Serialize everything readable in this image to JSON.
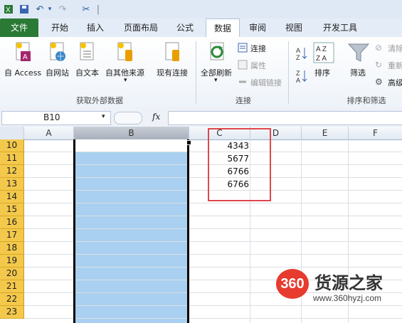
{
  "quick_access": {
    "undo_arrow": "▾",
    "separator": "|"
  },
  "tabs": [
    {
      "label": "文件"
    },
    {
      "label": "开始"
    },
    {
      "label": "插入"
    },
    {
      "label": "页面布局"
    },
    {
      "label": "公式"
    },
    {
      "label": "数据"
    },
    {
      "label": "审阅"
    },
    {
      "label": "视图"
    },
    {
      "label": "开发工具"
    }
  ],
  "ribbon": {
    "external_group": {
      "label": "获取外部数据",
      "buttons": [
        {
          "label": "自 Access"
        },
        {
          "label": "自网站"
        },
        {
          "label": "自文本"
        },
        {
          "label": "自其他来源"
        }
      ],
      "existing_label": "现有连接"
    },
    "connections_group": {
      "label": "连接",
      "refresh_label": "全部刷新",
      "items": [
        {
          "label": "连接"
        },
        {
          "label": "属性"
        },
        {
          "label": "编辑链接"
        }
      ]
    },
    "sort_group": {
      "label": "排序和筛选",
      "sort_label": "排序",
      "filter_label": "筛选",
      "items": [
        {
          "label": "清除"
        },
        {
          "label": "重新"
        },
        {
          "label": "高级"
        }
      ]
    }
  },
  "formula_bar": {
    "name_box": "B10",
    "fx": "fx",
    "formula": ""
  },
  "sheet": {
    "columns": [
      "A",
      "B",
      "C",
      "D",
      "E",
      "F"
    ],
    "rows": [
      "10",
      "11",
      "12",
      "13",
      "14",
      "15",
      "16",
      "17",
      "18",
      "19",
      "20",
      "21",
      "22",
      "23"
    ],
    "cells": [
      {
        "ref": "C10",
        "value": "4343"
      },
      {
        "ref": "C11",
        "value": "5677"
      },
      {
        "ref": "C12",
        "value": "6766"
      },
      {
        "ref": "C13",
        "value": "6766"
      }
    ]
  },
  "colors": {
    "selection": "#a9d0f0",
    "highlight_box": "#e0474c",
    "row_header": "#f3c84b",
    "file_tab": "#2a7a36"
  },
  "watermark": {
    "badge": "360",
    "title": "货源之家",
    "url": "www.360hyzj.com"
  }
}
